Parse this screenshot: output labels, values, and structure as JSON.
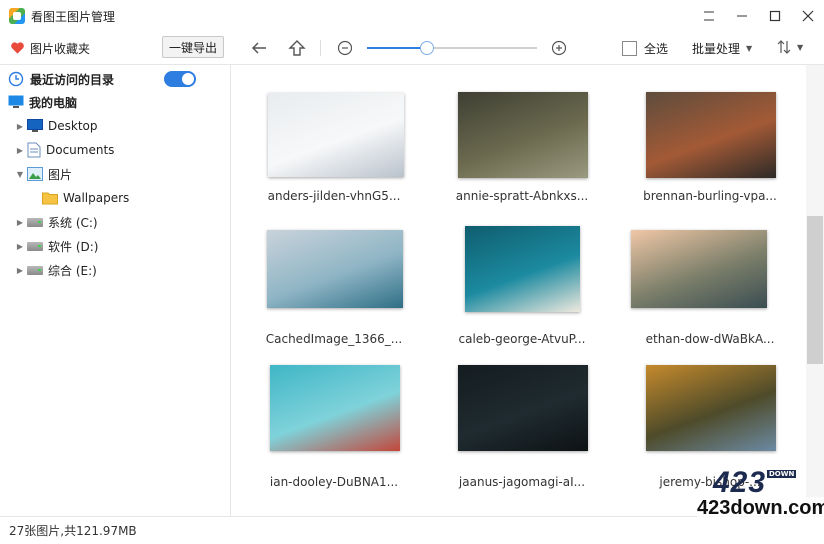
{
  "app": {
    "title": "看图王图片管理",
    "logo_icon": "app-logo-icon"
  },
  "window_controls": [
    "restore-icon",
    "minimize-icon",
    "maximize-icon",
    "close-icon"
  ],
  "toolbar": {
    "favorites_label": "图片收藏夹",
    "export_label": "一键导出",
    "back_icon": "arrow-left-icon",
    "up_icon": "arrow-up-icon",
    "zoom_out_icon": "zoom-out-icon",
    "zoom_in_icon": "zoom-in-icon",
    "zoom_level": 0.35,
    "select_all_label": "全选",
    "batch_label": "批量处理",
    "sort_icon": "sort-icon"
  },
  "sidebar": {
    "recent_label": "最近访问的目录",
    "recent_toggle_on": true,
    "tree": [
      {
        "label": "我的电脑",
        "icon": "monitor-icon",
        "level": 0,
        "expander": "none",
        "bold": true
      },
      {
        "label": "Desktop",
        "icon": "desktop-icon",
        "level": 1,
        "expander": "collapsed"
      },
      {
        "label": "Documents",
        "icon": "document-icon",
        "level": 1,
        "expander": "collapsed"
      },
      {
        "label": "图片",
        "icon": "pictures-icon",
        "level": 1,
        "expander": "expanded"
      },
      {
        "label": "Wallpapers",
        "icon": "folder-icon",
        "level": 2,
        "expander": "none"
      },
      {
        "label": "系统  (C:)",
        "icon": "drive-icon",
        "level": 1,
        "expander": "collapsed"
      },
      {
        "label": "软件  (D:)",
        "icon": "drive-icon",
        "level": 1,
        "expander": "collapsed"
      },
      {
        "label": "综合  (E:)",
        "icon": "drive-icon",
        "level": 1,
        "expander": "collapsed"
      }
    ]
  },
  "thumbnails": [
    {
      "name": "anders-jilden-vhnG5...",
      "colors": [
        "#e8ecef",
        "#f7f8f9",
        "#b9c2cc"
      ]
    },
    {
      "name": "annie-spratt-Abnkxs...",
      "colors": [
        "#3e3f33",
        "#6b6a4f",
        "#9a9a80"
      ]
    },
    {
      "name": "brennan-burling-vpa...",
      "colors": [
        "#5e4c3d",
        "#a35a36",
        "#2d2a27"
      ]
    },
    {
      "name": "CachedImage_1366_...",
      "colors": [
        "#c9d3db",
        "#8fb5c5",
        "#2f6f86"
      ]
    },
    {
      "name": "caleb-george-AtvuP...",
      "colors": [
        "#0f5d6e",
        "#1c8aa0",
        "#efe9de"
      ]
    },
    {
      "name": "ethan-dow-dWaBkA...",
      "colors": [
        "#f0c7a6",
        "#7c7f6a",
        "#3a4d52"
      ]
    },
    {
      "name": "ian-dooley-DuBNA1...",
      "colors": [
        "#3fb6c6",
        "#7fd2da",
        "#c2473b"
      ]
    },
    {
      "name": "jaanus-jagomagi-aI...",
      "colors": [
        "#141c20",
        "#1f2b30",
        "#0d1214"
      ]
    },
    {
      "name": "jeremy-bishop-...",
      "colors": [
        "#c58a2c",
        "#4e4b2a",
        "#6c8aa3"
      ]
    }
  ],
  "status": {
    "summary": "27张图片,共121.97MB"
  },
  "watermark": {
    "number": "423",
    "tag": "DOWN",
    "url": "423down.com"
  }
}
